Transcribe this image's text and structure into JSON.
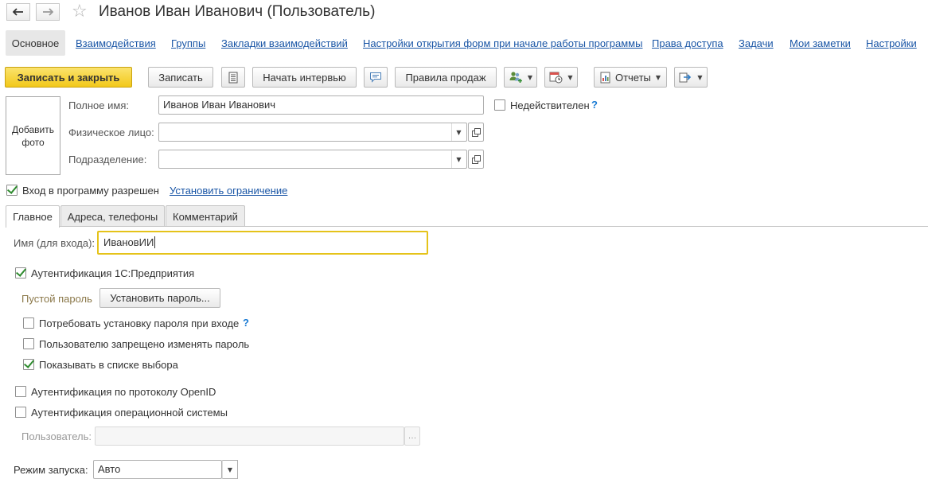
{
  "window": {
    "title": "Иванов Иван Иванович (Пользователь)"
  },
  "nav": {
    "back_icon": "arrow-left-icon",
    "forward_icon": "arrow-right-icon",
    "favorite_icon": "star-icon"
  },
  "sections": {
    "active": "Основное",
    "links": [
      "Взаимодействия",
      "Группы",
      "Закладки взаимодействий",
      "Настройки открытия форм при начале работы программы",
      "Права доступа",
      "Задачи",
      "Мои заметки",
      "Настройки"
    ]
  },
  "toolbar": {
    "save_close": "Записать и закрыть",
    "save": "Записать",
    "start_interview": "Начать интервью",
    "sales_rules": "Правила продаж",
    "reports": "Отчеты"
  },
  "photo": {
    "label_line1": "Добавить",
    "label_line2": "фото"
  },
  "form": {
    "full_name_label": "Полное имя:",
    "full_name_value": "Иванов Иван Иванович",
    "invalid_label": "Недействителен",
    "person_label": "Физическое лицо:",
    "person_value": "",
    "department_label": "Подразделение:",
    "department_value": "",
    "login_allowed_label": "Вход в программу разрешен",
    "set_restriction_link": "Установить ограничение"
  },
  "tabs": [
    "Главное",
    "Адреса, телефоны",
    "Комментарий"
  ],
  "main_tab": {
    "login_name_label": "Имя (для входа):",
    "login_name_value": "ИвановИИ",
    "auth_1c_label": "Аутентификация 1С:Предприятия",
    "empty_password_label": "Пустой пароль",
    "set_password_button": "Установить пароль...",
    "require_password_label": "Потребовать установку пароля при входе",
    "forbid_change_label": "Пользователю запрещено изменять пароль",
    "show_in_list_label": "Показывать в списке выбора",
    "openid_label": "Аутентификация по протоколу OpenID",
    "os_auth_label": "Аутентификация операционной системы",
    "os_user_label": "Пользователь:",
    "os_user_value": "",
    "launch_mode_label": "Режим запуска:",
    "launch_mode_value": "Авто"
  },
  "colors": {
    "primary": "#f2c81a",
    "link": "#1a56a6",
    "focus": "#e5c31a",
    "check": "#2e8b2e",
    "help": "#1a7bd4"
  }
}
